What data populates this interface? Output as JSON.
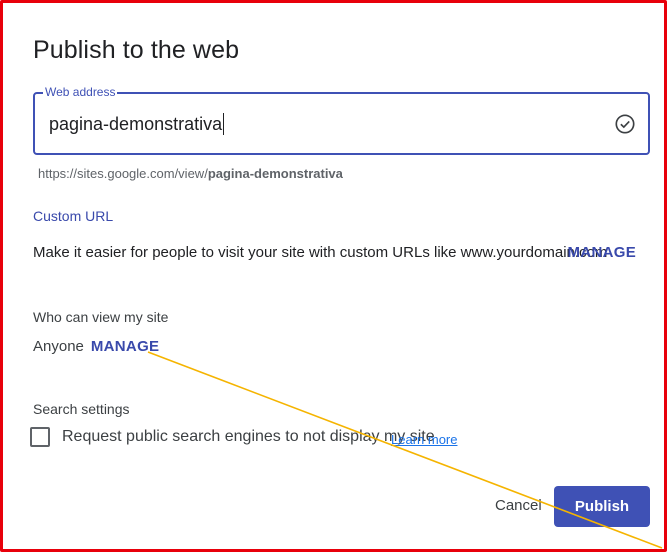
{
  "dialog": {
    "title": "Publish to the web"
  },
  "web_address": {
    "label": "Web address",
    "value": "pagina-demonstrativa",
    "hint_prefix": "https://sites.google.com/view/",
    "hint_path": "pagina-demonstrativa"
  },
  "custom_url": {
    "heading": "Custom URL",
    "description": "Make it easier for people to visit your site with custom URLs like www.yourdomain.com",
    "manage_label": "MANAGE"
  },
  "visibility": {
    "heading": "Who can view my site",
    "value": "Anyone",
    "manage_label": "MANAGE"
  },
  "search": {
    "heading": "Search settings",
    "checkbox_label": "Request public search engines to not display my site",
    "learn_more": "Learn more",
    "checked": false
  },
  "actions": {
    "cancel": "Cancel",
    "publish": "Publish"
  },
  "colors": {
    "accent": "#3f51b5",
    "frame": "#e8000b",
    "annotation_line": "#f5b400"
  }
}
